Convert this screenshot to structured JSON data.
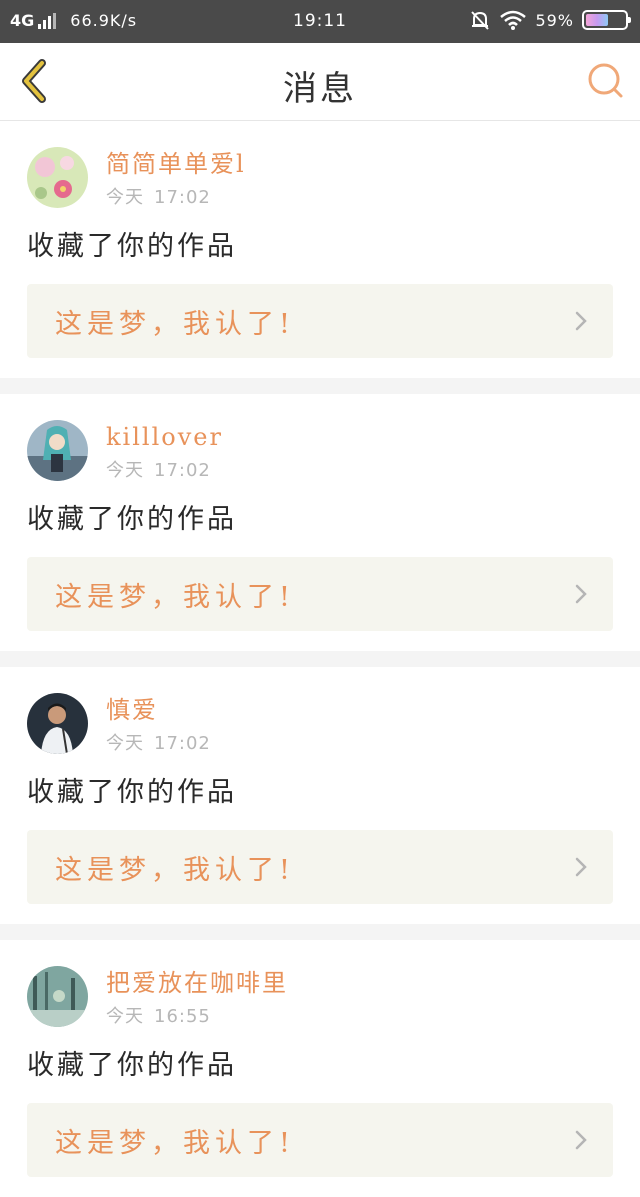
{
  "status_bar": {
    "network": "4G",
    "speed": "66.9K/s",
    "time": "19:11",
    "battery": "59%",
    "battery_level": 0.59
  },
  "header": {
    "title": "消息",
    "back_icon": "chevron-left-icon",
    "search_icon": "search-icon"
  },
  "colors": {
    "accent": "#e8925a",
    "card_link_bg": "#f5f5ee",
    "back_arrow": "#d4b23a"
  },
  "messages": [
    {
      "username": "简简单单爱l",
      "day": "今天",
      "time": "17:02",
      "action": "收藏了你的作品",
      "work_title": "这是梦，我认了!"
    },
    {
      "username": "killlover",
      "day": "今天",
      "time": "17:02",
      "action": "收藏了你的作品",
      "work_title": "这是梦，我认了!"
    },
    {
      "username": "慎爱",
      "day": "今天",
      "time": "17:02",
      "action": "收藏了你的作品",
      "work_title": "这是梦，我认了!"
    },
    {
      "username": "把爱放在咖啡里",
      "day": "今天",
      "time": "16:55",
      "action": "收藏了你的作品",
      "work_title": "这是梦，我认了!"
    }
  ]
}
